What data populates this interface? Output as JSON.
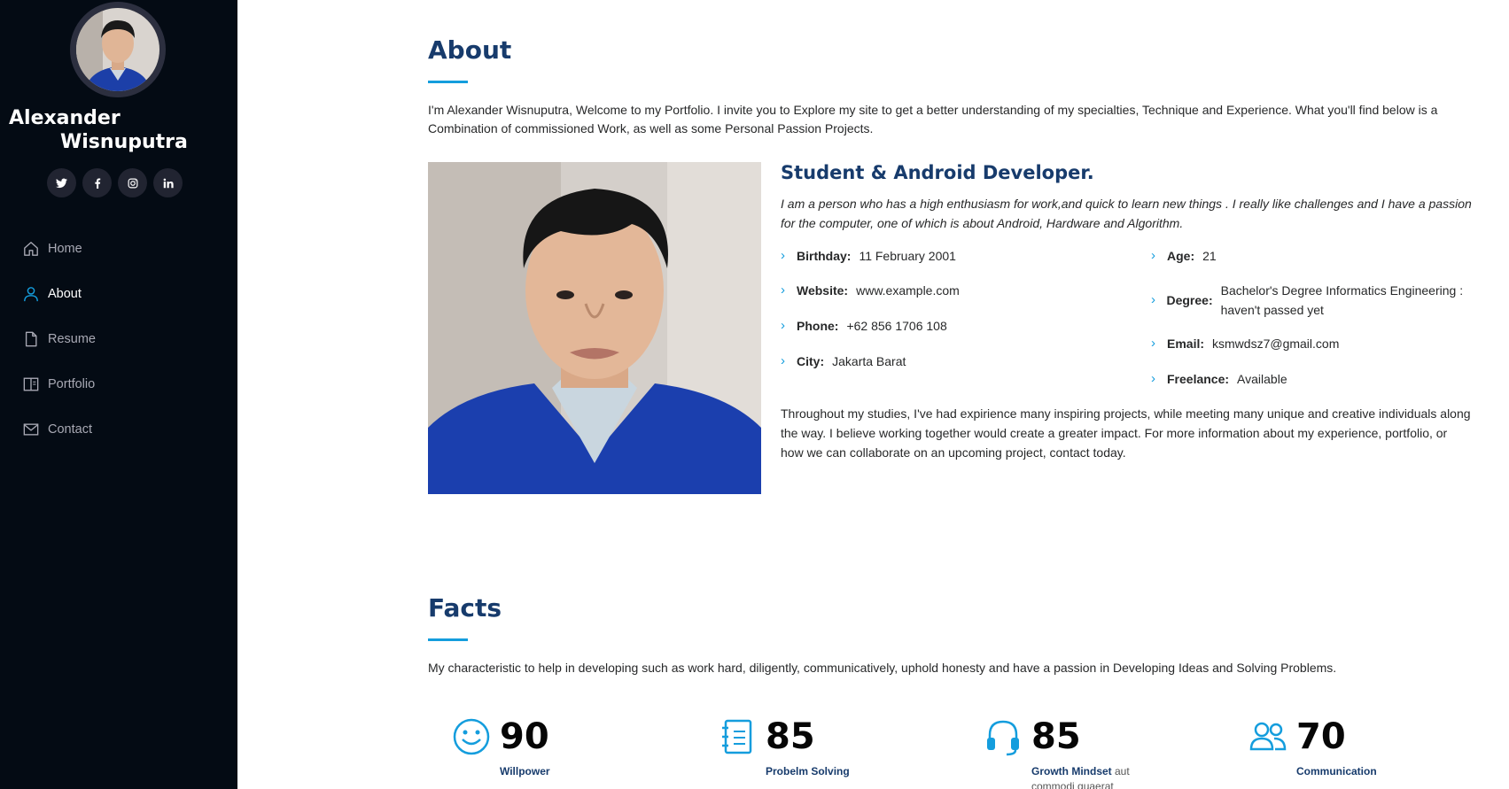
{
  "profile": {
    "first_name": "Alexander",
    "last_name": "Wisnuputra"
  },
  "social": [
    {
      "icon": "twitter-icon"
    },
    {
      "icon": "facebook-icon"
    },
    {
      "icon": "instagram-icon"
    },
    {
      "icon": "linkedin-icon"
    }
  ],
  "nav": [
    {
      "label": "Home",
      "icon": "home-icon",
      "active": false
    },
    {
      "label": "About",
      "icon": "person-icon",
      "active": true
    },
    {
      "label": "Resume",
      "icon": "file-icon",
      "active": false
    },
    {
      "label": "Portfolio",
      "icon": "book-icon",
      "active": false
    },
    {
      "label": "Contact",
      "icon": "envelope-icon",
      "active": false
    }
  ],
  "about": {
    "title": "About",
    "intro": "I'm Alexander Wisnuputra, Welcome to my Portfolio. I invite you to Explore my site to get a better understanding of my specialties, Technique and Experience. What you'll find below is a Combination of commissioned Work, as well as some Personal Passion Projects.",
    "role": "Student & Android Developer.",
    "tagline": "I am a person who has a high enthusiasm for work,and quick to learn new things . I really like challenges and I have a passion for the computer, one of which is about Android, Hardware and Algorithm.",
    "left_info": [
      {
        "label": "Birthday:",
        "value": "11 February 2001"
      },
      {
        "label": "Website:",
        "value": "www.example.com"
      },
      {
        "label": "Phone:",
        "value": "+62 856 1706 108"
      },
      {
        "label": "City:",
        "value": "Jakarta Barat"
      }
    ],
    "right_info": [
      {
        "label": "Age:",
        "value": "21"
      },
      {
        "label": "Degree:",
        "value": "Bachelor's Degree Informatics Engineering : haven't passed yet"
      },
      {
        "label": "Email:",
        "value": "ksmwdsz7@gmail.com"
      },
      {
        "label": "Freelance:",
        "value": "Available"
      }
    ],
    "closing": "Throughout my studies, I've had expirience many inspiring projects, while meeting many unique and creative individuals along the way. I believe working together would create a greater impact. For more information about my experience, portfolio, or how we can collaborate on an upcoming project, contact today."
  },
  "facts": {
    "title": "Facts",
    "intro": "My characteristic to help in developing such as work hard, diligently, communicatively, uphold honesty and have a passion in Developing Ideas and Solving Problems.",
    "items": [
      {
        "icon": "smiley-icon",
        "number": "90",
        "label": "Willpower",
        "rest": ""
      },
      {
        "icon": "journal-icon",
        "number": "85",
        "label": "Probelm Solving",
        "rest": ""
      },
      {
        "icon": "headset-icon",
        "number": "85",
        "label": "Growth Mindset",
        "rest": " aut commodi quaerat"
      },
      {
        "icon": "people-icon",
        "number": "70",
        "label": "Communication",
        "rest": ""
      }
    ]
  },
  "colors": {
    "sidebar_bg": "#040b14",
    "accent": "#149ddd",
    "heading": "#173b6c"
  }
}
